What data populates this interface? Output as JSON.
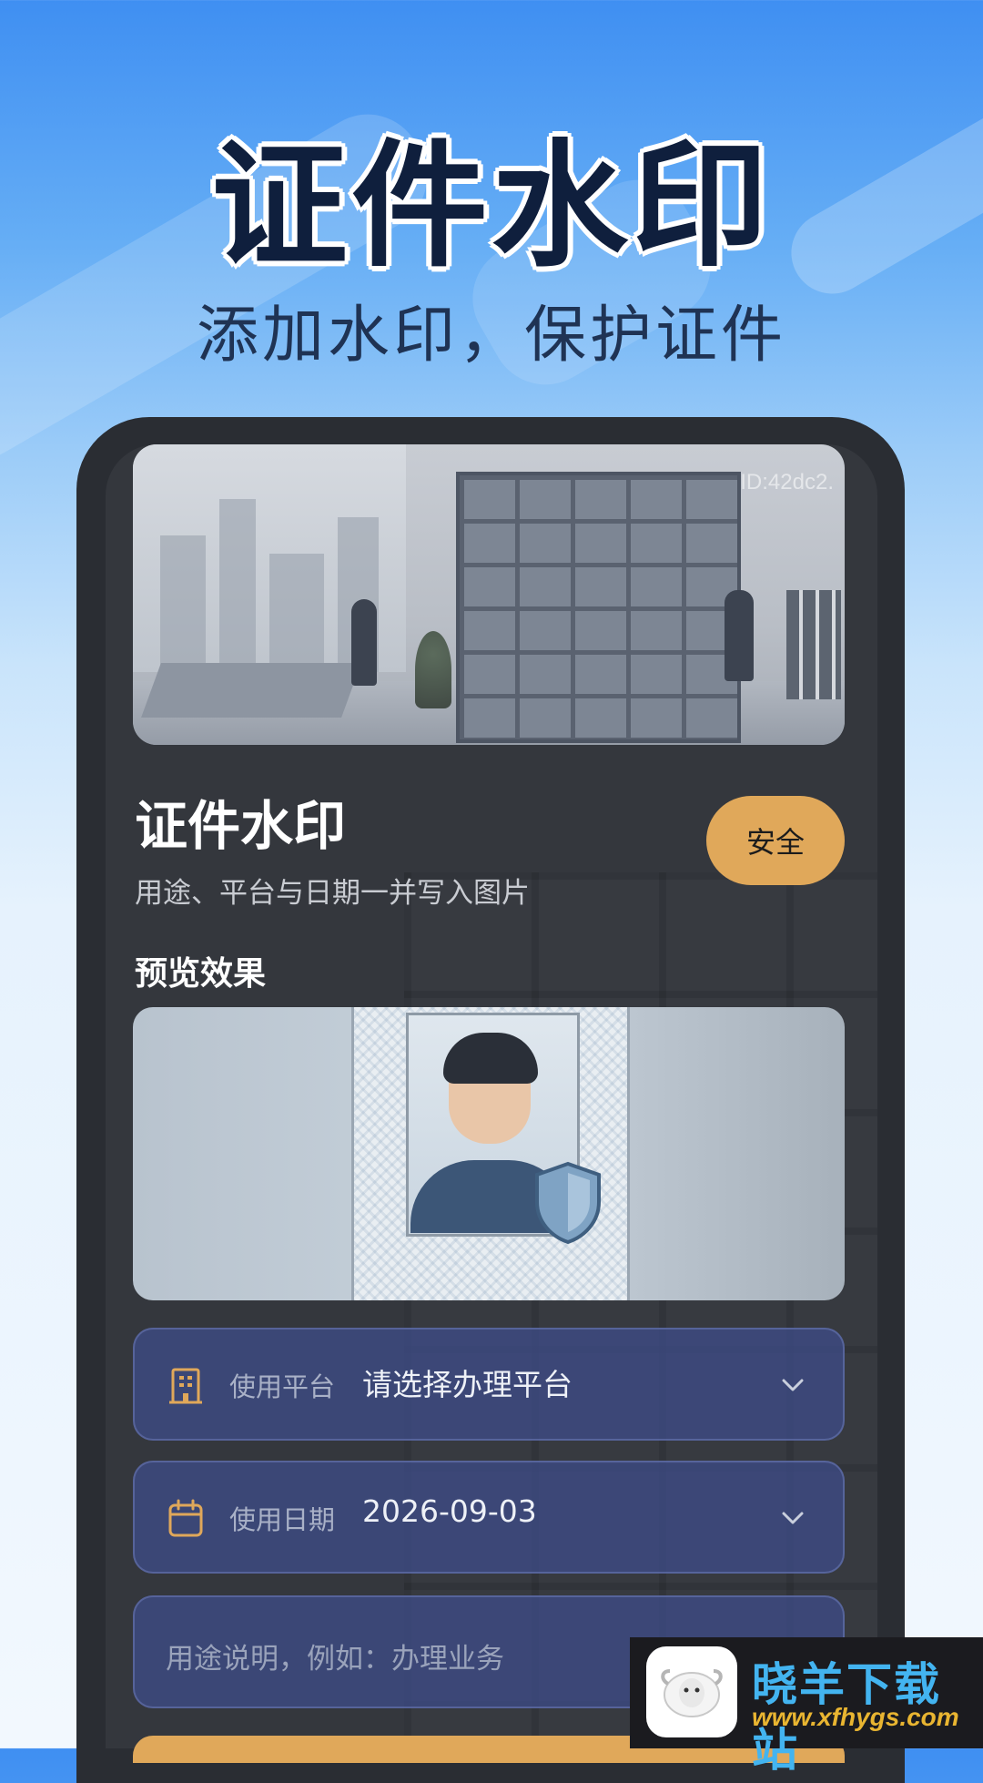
{
  "hero": {
    "title": "证件水印",
    "subtitle": "添加水印，保护证件"
  },
  "banner": {
    "id_text": "ID:42dc2."
  },
  "card": {
    "title": "证件水印",
    "description": "用途、平台与日期一并写入图片",
    "badge": "安全",
    "preview_label": "预览效果"
  },
  "form": {
    "platform": {
      "label": "使用平台",
      "value": "请选择办理平台",
      "icon": "building-icon"
    },
    "date": {
      "label": "使用日期",
      "value": "2026-09-03",
      "icon": "calendar-icon"
    },
    "purpose": {
      "placeholder": "用途说明，例如：办理业务"
    }
  },
  "watermark": {
    "brand": "晓羊下载站",
    "url": "www.xfhygs.com"
  },
  "colors": {
    "accent": "#e0a85a",
    "field_bg": "#3e4b87",
    "screen_bg": "#34373d"
  }
}
